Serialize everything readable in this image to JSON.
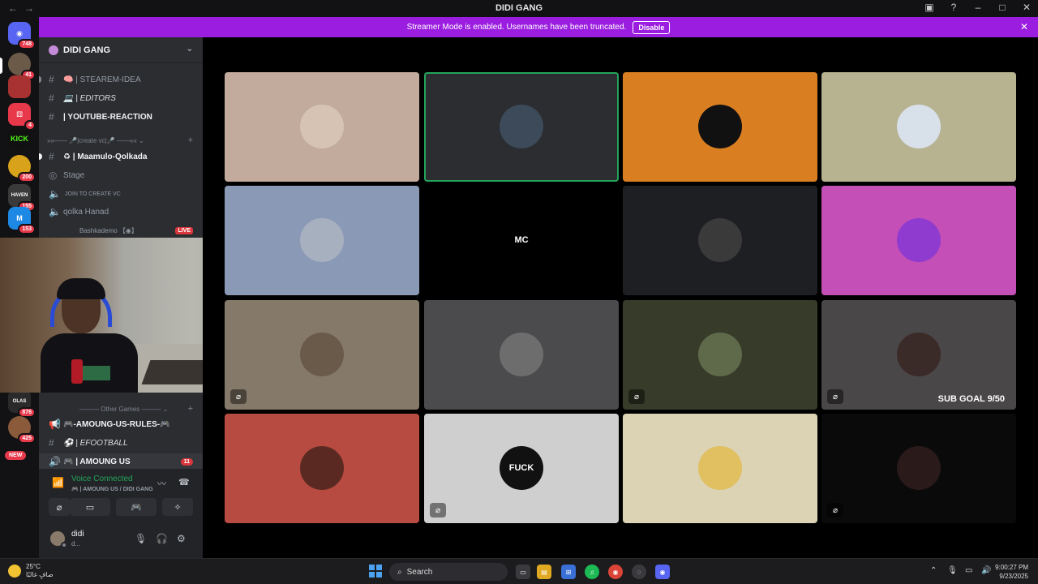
{
  "window": {
    "title": "DIDI GANG",
    "nav_back": "←",
    "nav_forward": "→"
  },
  "banner": {
    "text": "Streamer Mode is enabled. Usernames have been truncated.",
    "button": "Disable"
  },
  "servers": [
    {
      "badge": "748",
      "color": "#5865f2",
      "glyph": "◉"
    },
    {
      "badge": "41",
      "color": "#6b5a48",
      "glyph": ""
    },
    {
      "badge": "",
      "color": "#a83232",
      "glyph": ""
    },
    {
      "badge": "4",
      "color": "#e8394b",
      "glyph": ""
    },
    {
      "badge": "",
      "color": "#111111",
      "glyph": "KICK"
    },
    {
      "badge": "200",
      "color": "#d9a21b",
      "glyph": ""
    },
    {
      "badge": "155",
      "color": "#3a3a3a",
      "glyph": "HAVEN"
    },
    {
      "badge": "153",
      "color": "#1e88e5",
      "glyph": "M"
    },
    {
      "badge": "876",
      "color": "#2a2a2a",
      "glyph": "OLAS"
    },
    {
      "badge": "425",
      "color": "#8a5a3a",
      "glyph": ""
    }
  ],
  "new_badge": "NEW",
  "guild": {
    "name": "DIDI GANG"
  },
  "channels": {
    "stearem": "🧠 | STEAREM-IDEA",
    "editors": "💻 | EDITORS",
    "youtube": "| YOUTUBE-REACTION",
    "category_create": "»»—— 🎤|create vc|🎤 ——«« ⌄",
    "maamulo": "♻ | Maamulo-Qolkada",
    "stage": "Stage",
    "join_create": "JOIN TO CREATE VC",
    "qolka": "qolka Hanad",
    "member": "Bashkademo 【◉】",
    "live": "LIVE",
    "category_games": "——— Other Games ——— ⌄",
    "amoung_rules": "🎮-AMOUNG-US-RULES-🎮",
    "efootball": "⚽ | EFOOTBALL",
    "amoung_us": "🎮 | AMOUNG US",
    "amoung_count": "11"
  },
  "voice": {
    "status": "Voice Connected",
    "channel": "🎮 | AMOUNG US / DIDI GANG"
  },
  "user": {
    "name": "didi",
    "status": "d..."
  },
  "tiles": [
    {
      "bg": "#c2ab9c",
      "av": "#d6c3b4",
      "mute": false
    },
    {
      "bg": "#2b2d31",
      "av": "#3c4a5a",
      "mute": false,
      "speaking": true
    },
    {
      "bg": "#d97f22",
      "av": "#111111",
      "mute": false
    },
    {
      "bg": "#b7b290",
      "av": "#d8e0ea",
      "mute": false
    },
    {
      "bg": "#8a9ab6",
      "av": "#a7b0bf",
      "mute": false
    },
    {
      "bg": "#000000",
      "av": "#000000",
      "mute": false,
      "glyph": "MC"
    },
    {
      "bg": "#1e1f22",
      "av": "#3a3a3a",
      "mute": false
    },
    {
      "bg": "#c44fb7",
      "av": "#8f3bd0",
      "mute": false
    },
    {
      "bg": "#857a6a",
      "av": "#6a5a4a",
      "mute": true
    },
    {
      "bg": "#4b4b4d",
      "av": "#6d6d6d",
      "mute": false
    },
    {
      "bg": "#373b29",
      "av": "#5f6a4a",
      "mute": true
    },
    {
      "bg": "#4a4748",
      "av": "#3a2a28",
      "mute": true,
      "subgoal": "SUB GOAL 9/50"
    },
    {
      "bg": "#b84b41",
      "av": "#5a2a22",
      "mute": false
    },
    {
      "bg": "#cfcfcf",
      "av": "#111111",
      "mute": true,
      "glyph": "FUCK"
    },
    {
      "bg": "#dcd2b4",
      "av": "#e0c060",
      "mute": false
    },
    {
      "bg": "#0a0a0a",
      "av": "#2a1a1a",
      "mute": true
    }
  ],
  "taskbar": {
    "temp": "25°C",
    "weather": "صافٍ غالبًا",
    "search": "Search",
    "time": "9:00:27 PM",
    "date": "9/23/2025"
  }
}
